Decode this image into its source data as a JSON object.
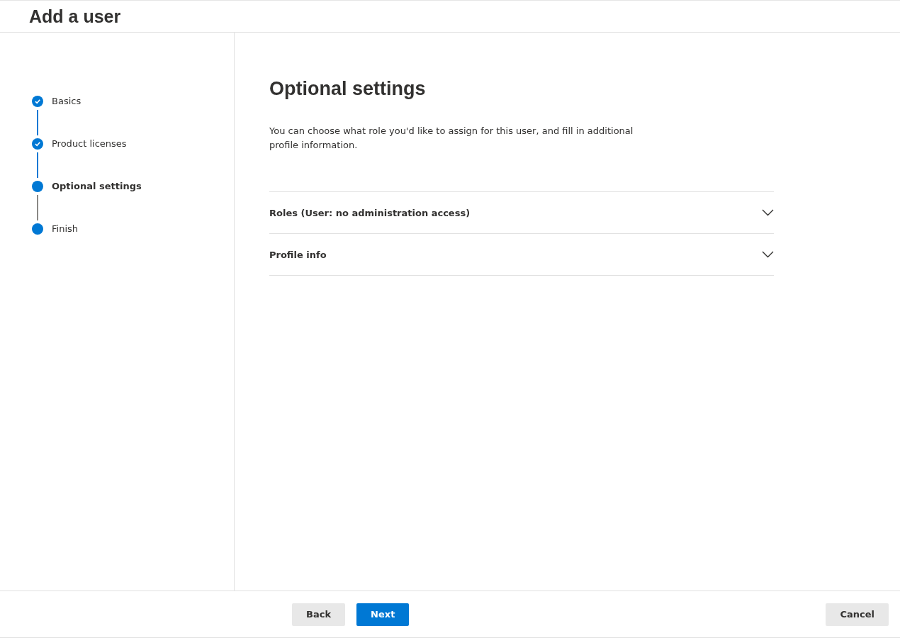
{
  "header": {
    "title": "Add a user"
  },
  "steps": [
    {
      "label": "Basics",
      "completed": true,
      "selected": false
    },
    {
      "label": "Product licenses",
      "completed": true,
      "selected": false
    },
    {
      "label": "Optional settings",
      "completed": false,
      "selected": true
    },
    {
      "label": "Finish",
      "completed": false,
      "selected": false
    }
  ],
  "main": {
    "title": "Optional settings",
    "description": "You can choose what role you'd like to assign for this user, and fill in additional profile information.",
    "sections": [
      {
        "label": "Roles (User: no administration access)",
        "expanded": false
      },
      {
        "label": "Profile info",
        "expanded": false
      }
    ]
  },
  "footer": {
    "buttons": [
      {
        "label": "Back",
        "kind": "secondary"
      },
      {
        "label": "Next",
        "kind": "primary"
      }
    ],
    "cancel": {
      "label": "Cancel"
    }
  }
}
